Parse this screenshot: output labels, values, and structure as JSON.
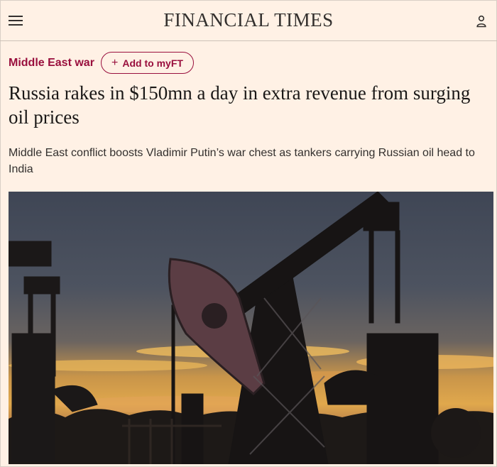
{
  "header": {
    "masthead": "FINANCIAL TIMES",
    "menu_icon": "hamburger-menu-icon",
    "user_icon": "user-icon"
  },
  "article": {
    "topic": "Middle East war",
    "follow_button": "Add to myFT",
    "follow_icon": "plus-icon",
    "headline": "Russia rakes in $150mn a day in extra revenue from surging oil prices",
    "standfirst": "Middle East conflict boosts Vladimir Putin’s war chest as tankers carrying Russian oil head to India"
  },
  "colors": {
    "background": "#fff1e5",
    "accent": "#990f3d",
    "text": "#33302e"
  }
}
